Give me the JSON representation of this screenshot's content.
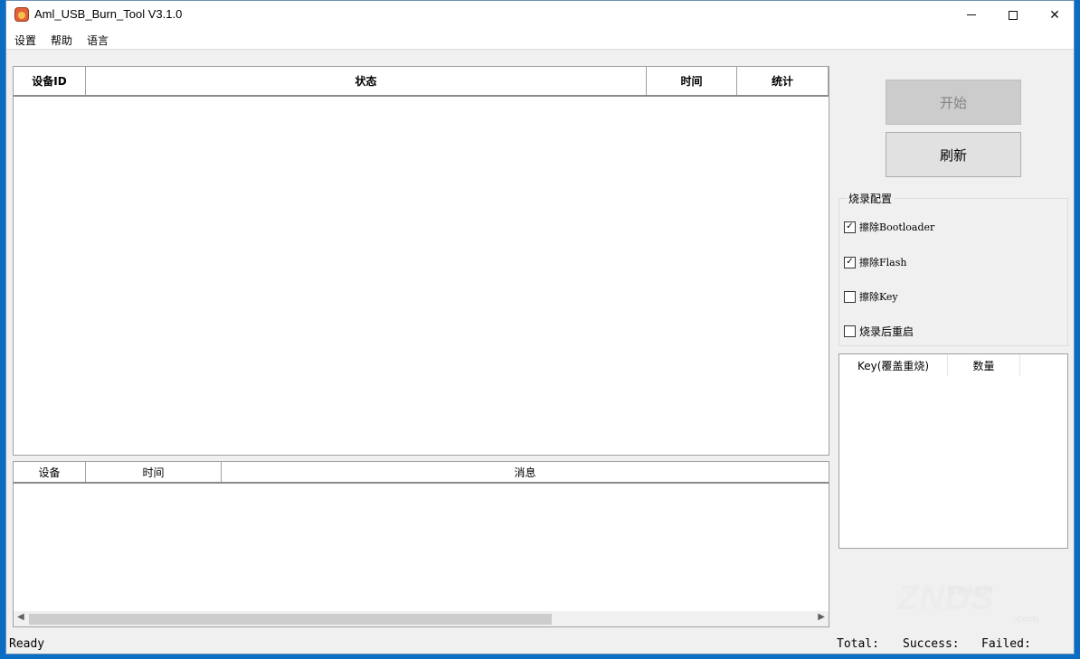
{
  "window": {
    "title": "Aml_USB_Burn_Tool V3.1.0"
  },
  "menu": [
    "设置",
    "帮助",
    "语言"
  ],
  "device_table": {
    "columns": [
      "设备ID",
      "状态",
      "时间",
      "统计"
    ]
  },
  "log_table": {
    "columns": [
      "设备",
      "时间",
      "消息"
    ]
  },
  "buttons": {
    "start": "开始",
    "refresh": "刷新"
  },
  "burn_config": {
    "title": "烧录配置",
    "options": [
      {
        "label": "擦除Bootloader",
        "checked": true
      },
      {
        "label": "擦除Flash",
        "checked": true
      },
      {
        "label": "擦除Key",
        "checked": false
      },
      {
        "label": "烧录后重启",
        "checked": false
      }
    ]
  },
  "key_table": {
    "columns": [
      "Key(覆盖重烧)",
      "数量"
    ]
  },
  "watermark": {
    "logo": "ZNDS",
    "sub": "智能电视网",
    "domain": ".com"
  },
  "status": {
    "ready": "Ready",
    "total": "Total:",
    "success": "Success:",
    "failed": "Failed:"
  }
}
